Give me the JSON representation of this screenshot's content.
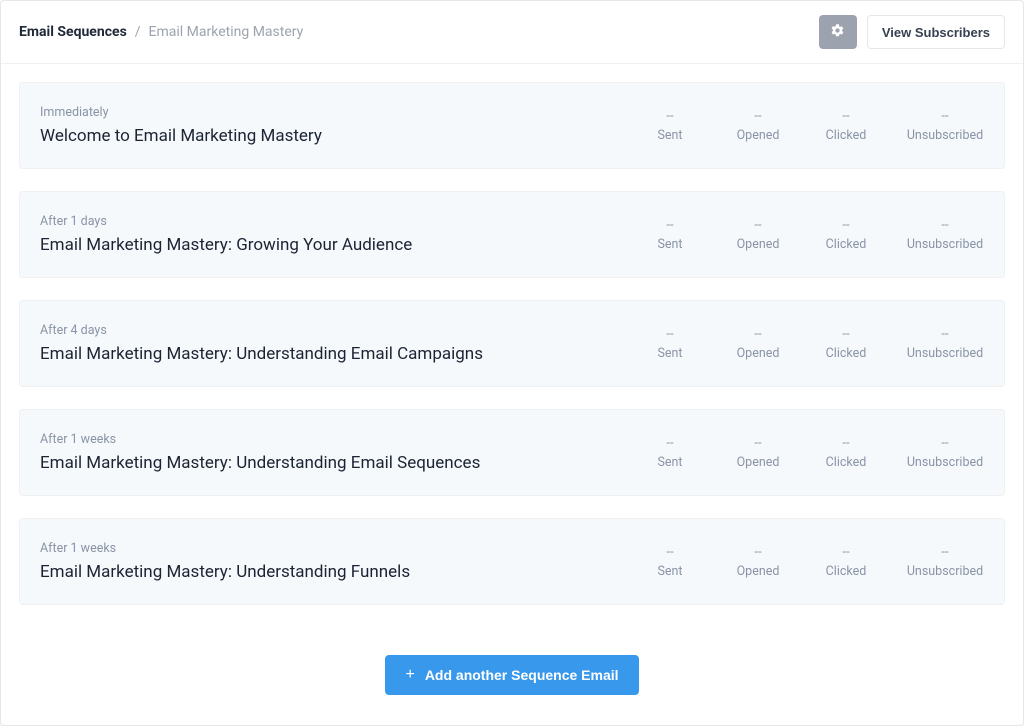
{
  "breadcrumb": {
    "root": "Email Sequences",
    "separator": "/",
    "current": "Email Marketing Mastery"
  },
  "header": {
    "view_subscribers_label": "View Subscribers"
  },
  "stat_labels": {
    "sent": "Sent",
    "opened": "Opened",
    "clicked": "Clicked",
    "unsubscribed": "Unsubscribed"
  },
  "emails": [
    {
      "delay": "Immediately",
      "title": "Welcome to Email Marketing Mastery",
      "sent": "--",
      "opened": "--",
      "clicked": "--",
      "unsubscribed": "--"
    },
    {
      "delay": "After 1 days",
      "title": "Email Marketing Mastery: Growing Your Audience",
      "sent": "--",
      "opened": "--",
      "clicked": "--",
      "unsubscribed": "--"
    },
    {
      "delay": "After 4 days",
      "title": "Email Marketing Mastery: Understanding Email Campaigns",
      "sent": "--",
      "opened": "--",
      "clicked": "--",
      "unsubscribed": "--"
    },
    {
      "delay": "After 1 weeks",
      "title": "Email Marketing Mastery: Understanding Email Sequences",
      "sent": "--",
      "opened": "--",
      "clicked": "--",
      "unsubscribed": "--"
    },
    {
      "delay": "After 1 weeks",
      "title": "Email Marketing Mastery: Understanding Funnels",
      "sent": "--",
      "opened": "--",
      "clicked": "--",
      "unsubscribed": "--"
    }
  ],
  "add_button_label": "Add another Sequence Email"
}
